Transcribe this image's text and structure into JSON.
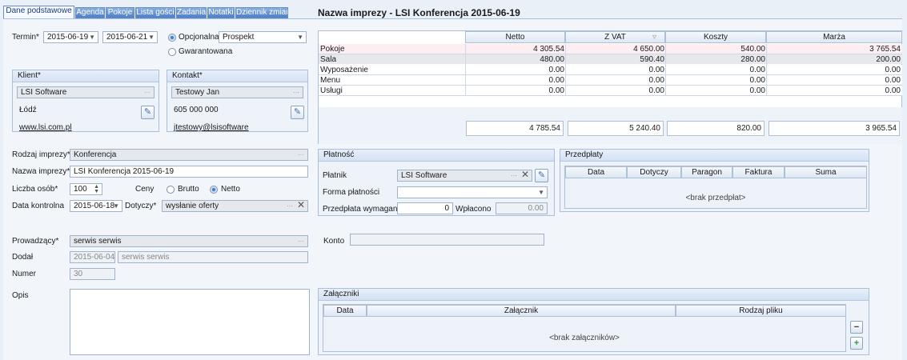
{
  "tabs": [
    {
      "label": "Dane podstawowe"
    },
    {
      "label": "Agenda"
    },
    {
      "label": "Pokoje"
    },
    {
      "label": "Lista gości"
    },
    {
      "label": "Zadania"
    },
    {
      "label": "Notatki"
    },
    {
      "label": "Dziennik zmian"
    }
  ],
  "title": "Nazwa imprezy - LSI Konferencja 2015-06-19",
  "termin": {
    "label": "Termin*",
    "from": "2015-06-19",
    "to": "2015-06-21",
    "opt_label": "Opcjonalna",
    "opt_value": "Prospekt",
    "guar_label": "Gwarantowana"
  },
  "klient": {
    "header": "Klient*",
    "name": "LSI Software",
    "city": "Łódź",
    "www": "www.lsi.com.pl"
  },
  "kontakt": {
    "header": "Kontakt*",
    "name": "Testowy Jan",
    "phone": "605 000 000",
    "email": "jtestowy@lsisoftware"
  },
  "summary": {
    "columns": [
      "Netto",
      "Z VAT",
      "Koszty",
      "Marża"
    ],
    "rows": [
      {
        "name": "Pokoje",
        "netto": "4 305.54",
        "zvat": "4 650.00",
        "koszty": "540.00",
        "marza": "3 765.54"
      },
      {
        "name": "Sala",
        "netto": "480.00",
        "zvat": "590.40",
        "koszty": "280.00",
        "marza": "200.00"
      },
      {
        "name": "Wyposażenie",
        "netto": "0.00",
        "zvat": "0.00",
        "koszty": "0.00",
        "marza": "0.00"
      },
      {
        "name": "Menu",
        "netto": "0.00",
        "zvat": "0.00",
        "koszty": "0.00",
        "marza": "0.00"
      },
      {
        "name": "Usługi",
        "netto": "0.00",
        "zvat": "0.00",
        "koszty": "0.00",
        "marza": "0.00"
      }
    ],
    "totals": {
      "netto": "4 785.54",
      "zvat": "5 240.40",
      "koszty": "820.00",
      "marza": "3 965.54"
    }
  },
  "form": {
    "rodzaj_label": "Rodzaj imprezy*",
    "rodzaj_value": "Konferencja",
    "nazwa_label": "Nazwa imprezy*",
    "nazwa_value": "LSI Konferencja 2015-06-19",
    "liczba_label": "Liczba osób*",
    "liczba_value": "100",
    "ceny_label": "Ceny",
    "brutto_label": "Brutto",
    "netto_label": "Netto",
    "kontrolna_label": "Data kontrolna",
    "kontrolna_value": "2015-06-18",
    "dotyczy_label": "Dotyczy*",
    "dotyczy_value": "wysłanie oferty",
    "prowadzacy_label": "Prowadzący*",
    "prowadzacy_value": "serwis serwis",
    "dodal_label": "Dodał",
    "dodal_date": "2015-06-04",
    "dodal_user": "serwis serwis",
    "numer_label": "Numer",
    "numer_value": "30",
    "opis_label": "Opis"
  },
  "platnosc": {
    "header": "Płatność",
    "platnik_label": "Płatnik",
    "platnik_value": "LSI Software",
    "forma_label": "Forma płatności",
    "przedplata_label": "Przedpłata wymagana",
    "przedplata_value": "0",
    "wplacono_label": "Wpłacono",
    "wplacono_value": "0.00",
    "konto_label": "Konto"
  },
  "przedplaty": {
    "header": "Przedpłaty",
    "columns": [
      "Data",
      "Dotyczy",
      "Paragon",
      "Faktura",
      "Suma"
    ],
    "empty": "<brak przedpłat>"
  },
  "zalaczniki": {
    "header": "Załączniki",
    "columns": [
      "Data",
      "Załącznik",
      "Rodzaj pliku"
    ],
    "empty": "<brak załączników>"
  }
}
